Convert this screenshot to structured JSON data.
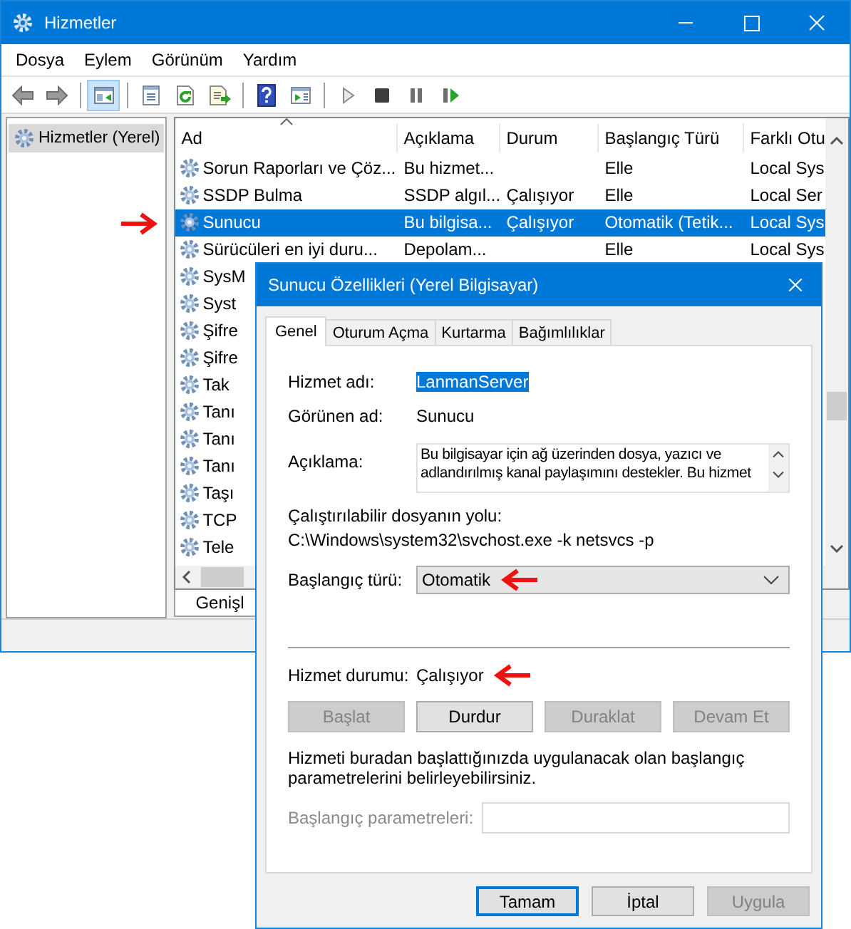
{
  "window": {
    "title": "Hizmetler"
  },
  "menu": [
    "Dosya",
    "Eylem",
    "Görünüm",
    "Yardım"
  ],
  "toolbar": [
    [
      {
        "kind": "back",
        "pressed": false
      },
      {
        "kind": "forward",
        "pressed": false
      }
    ],
    [
      {
        "kind": "tree",
        "pressed": true
      }
    ],
    [
      {
        "kind": "properties",
        "pressed": false
      },
      {
        "kind": "refresh",
        "pressed": false
      },
      {
        "kind": "export",
        "pressed": false
      }
    ],
    [
      {
        "kind": "help",
        "pressed": false
      },
      {
        "kind": "console",
        "pressed": false
      }
    ],
    [
      {
        "kind": "play",
        "pressed": false
      },
      {
        "kind": "stop",
        "pressed": false
      },
      {
        "kind": "pause",
        "pressed": false
      },
      {
        "kind": "restart",
        "pressed": false
      }
    ]
  ],
  "tree": [
    {
      "label": "Hizmetler (Yerel)",
      "selected": true
    }
  ],
  "list": {
    "columns": [
      {
        "label": "Ad",
        "sorted": true
      },
      {
        "label": "Açıklama",
        "sorted": false
      },
      {
        "label": "Durum",
        "sorted": false
      },
      {
        "label": "Başlangıç Türü",
        "sorted": false
      },
      {
        "label": "Farklı Otu",
        "sorted": false
      }
    ],
    "rows": [
      {
        "name": "Sorun Raporları ve Çöz...",
        "description": "Bu hizmet...",
        "status": "",
        "startup": "Elle",
        "logon": "Local Sys",
        "selected": false
      },
      {
        "name": "SSDP Bulma",
        "description": "SSDP algıl...",
        "status": "Çalışıyor",
        "startup": "Elle",
        "logon": "Local Ser",
        "selected": false
      },
      {
        "name": "Sunucu",
        "description": "Bu bilgisa...",
        "status": "Çalışıyor",
        "startup": "Otomatik (Tetik...",
        "logon": "Local Sys",
        "selected": true,
        "arrow": true
      },
      {
        "name": "Sürücüleri en iyi duru...",
        "description": "Depolam...",
        "status": "",
        "startup": "Elle",
        "logon": "Local Sys",
        "selected": false
      },
      {
        "name": "SysM",
        "selected": false
      },
      {
        "name": "Syst",
        "selected": false
      },
      {
        "name": "Şifre",
        "selected": false
      },
      {
        "name": "Şifre",
        "selected": false
      },
      {
        "name": "Tak",
        "selected": false
      },
      {
        "name": "Tanı",
        "selected": false
      },
      {
        "name": "Tanı",
        "selected": false
      },
      {
        "name": "Tanı",
        "selected": false
      },
      {
        "name": "Taşı",
        "selected": false
      },
      {
        "name": "TCP",
        "selected": false
      },
      {
        "name": "Tele",
        "selected": false
      }
    ]
  },
  "bottom_tabs": [
    {
      "label": "Genişl",
      "selected": true
    }
  ],
  "dialog": {
    "title": "Sunucu Özellikleri (Yerel Bilgisayar)",
    "tabs": [
      {
        "label": "Genel",
        "selected": true
      },
      {
        "label": "Oturum Açma",
        "selected": false
      },
      {
        "label": "Kurtarma",
        "selected": false
      },
      {
        "label": "Bağımlılıklar",
        "selected": false
      }
    ],
    "service_name": {
      "label": "Hizmet adı:",
      "value": "LanmanServer",
      "highlighted": true
    },
    "display_name": {
      "label": "Görünen ad:",
      "value": "Sunucu"
    },
    "description": {
      "label": "Açıklama:",
      "value": "Bu bilgisayar için ağ üzerinden dosya, yazıcı ve adlandırılmış kanal paylaşımını destekler. Bu hizmet"
    },
    "path": {
      "label": "Çalıştırılabilir dosyanın yolu:",
      "value": "C:\\Windows\\system32\\svchost.exe -k netsvcs -p"
    },
    "startup_type": {
      "label": "Başlangıç türü:",
      "value": "Otomatik",
      "arrow": true
    },
    "service_status": {
      "label": "Hizmet durumu:",
      "value": "Çalışıyor",
      "arrow": true
    },
    "service_buttons": [
      {
        "label": "Başlat",
        "disabled": true
      },
      {
        "label": "Durdur",
        "disabled": false
      },
      {
        "label": "Duraklat",
        "disabled": true
      },
      {
        "label": "Devam Et",
        "disabled": true
      }
    ],
    "note": "Hizmeti buradan başlattığınızda uygulanacak olan başlangıç parametrelerini belirleyebilirsiniz.",
    "start_params": {
      "label": "Başlangıç parametreleri:",
      "disabled": true
    },
    "buttons": [
      {
        "label": "Tamam",
        "default": true,
        "disabled": false
      },
      {
        "label": "İptal",
        "default": false,
        "disabled": false
      },
      {
        "label": "Uygula",
        "default": false,
        "disabled": true
      }
    ]
  }
}
